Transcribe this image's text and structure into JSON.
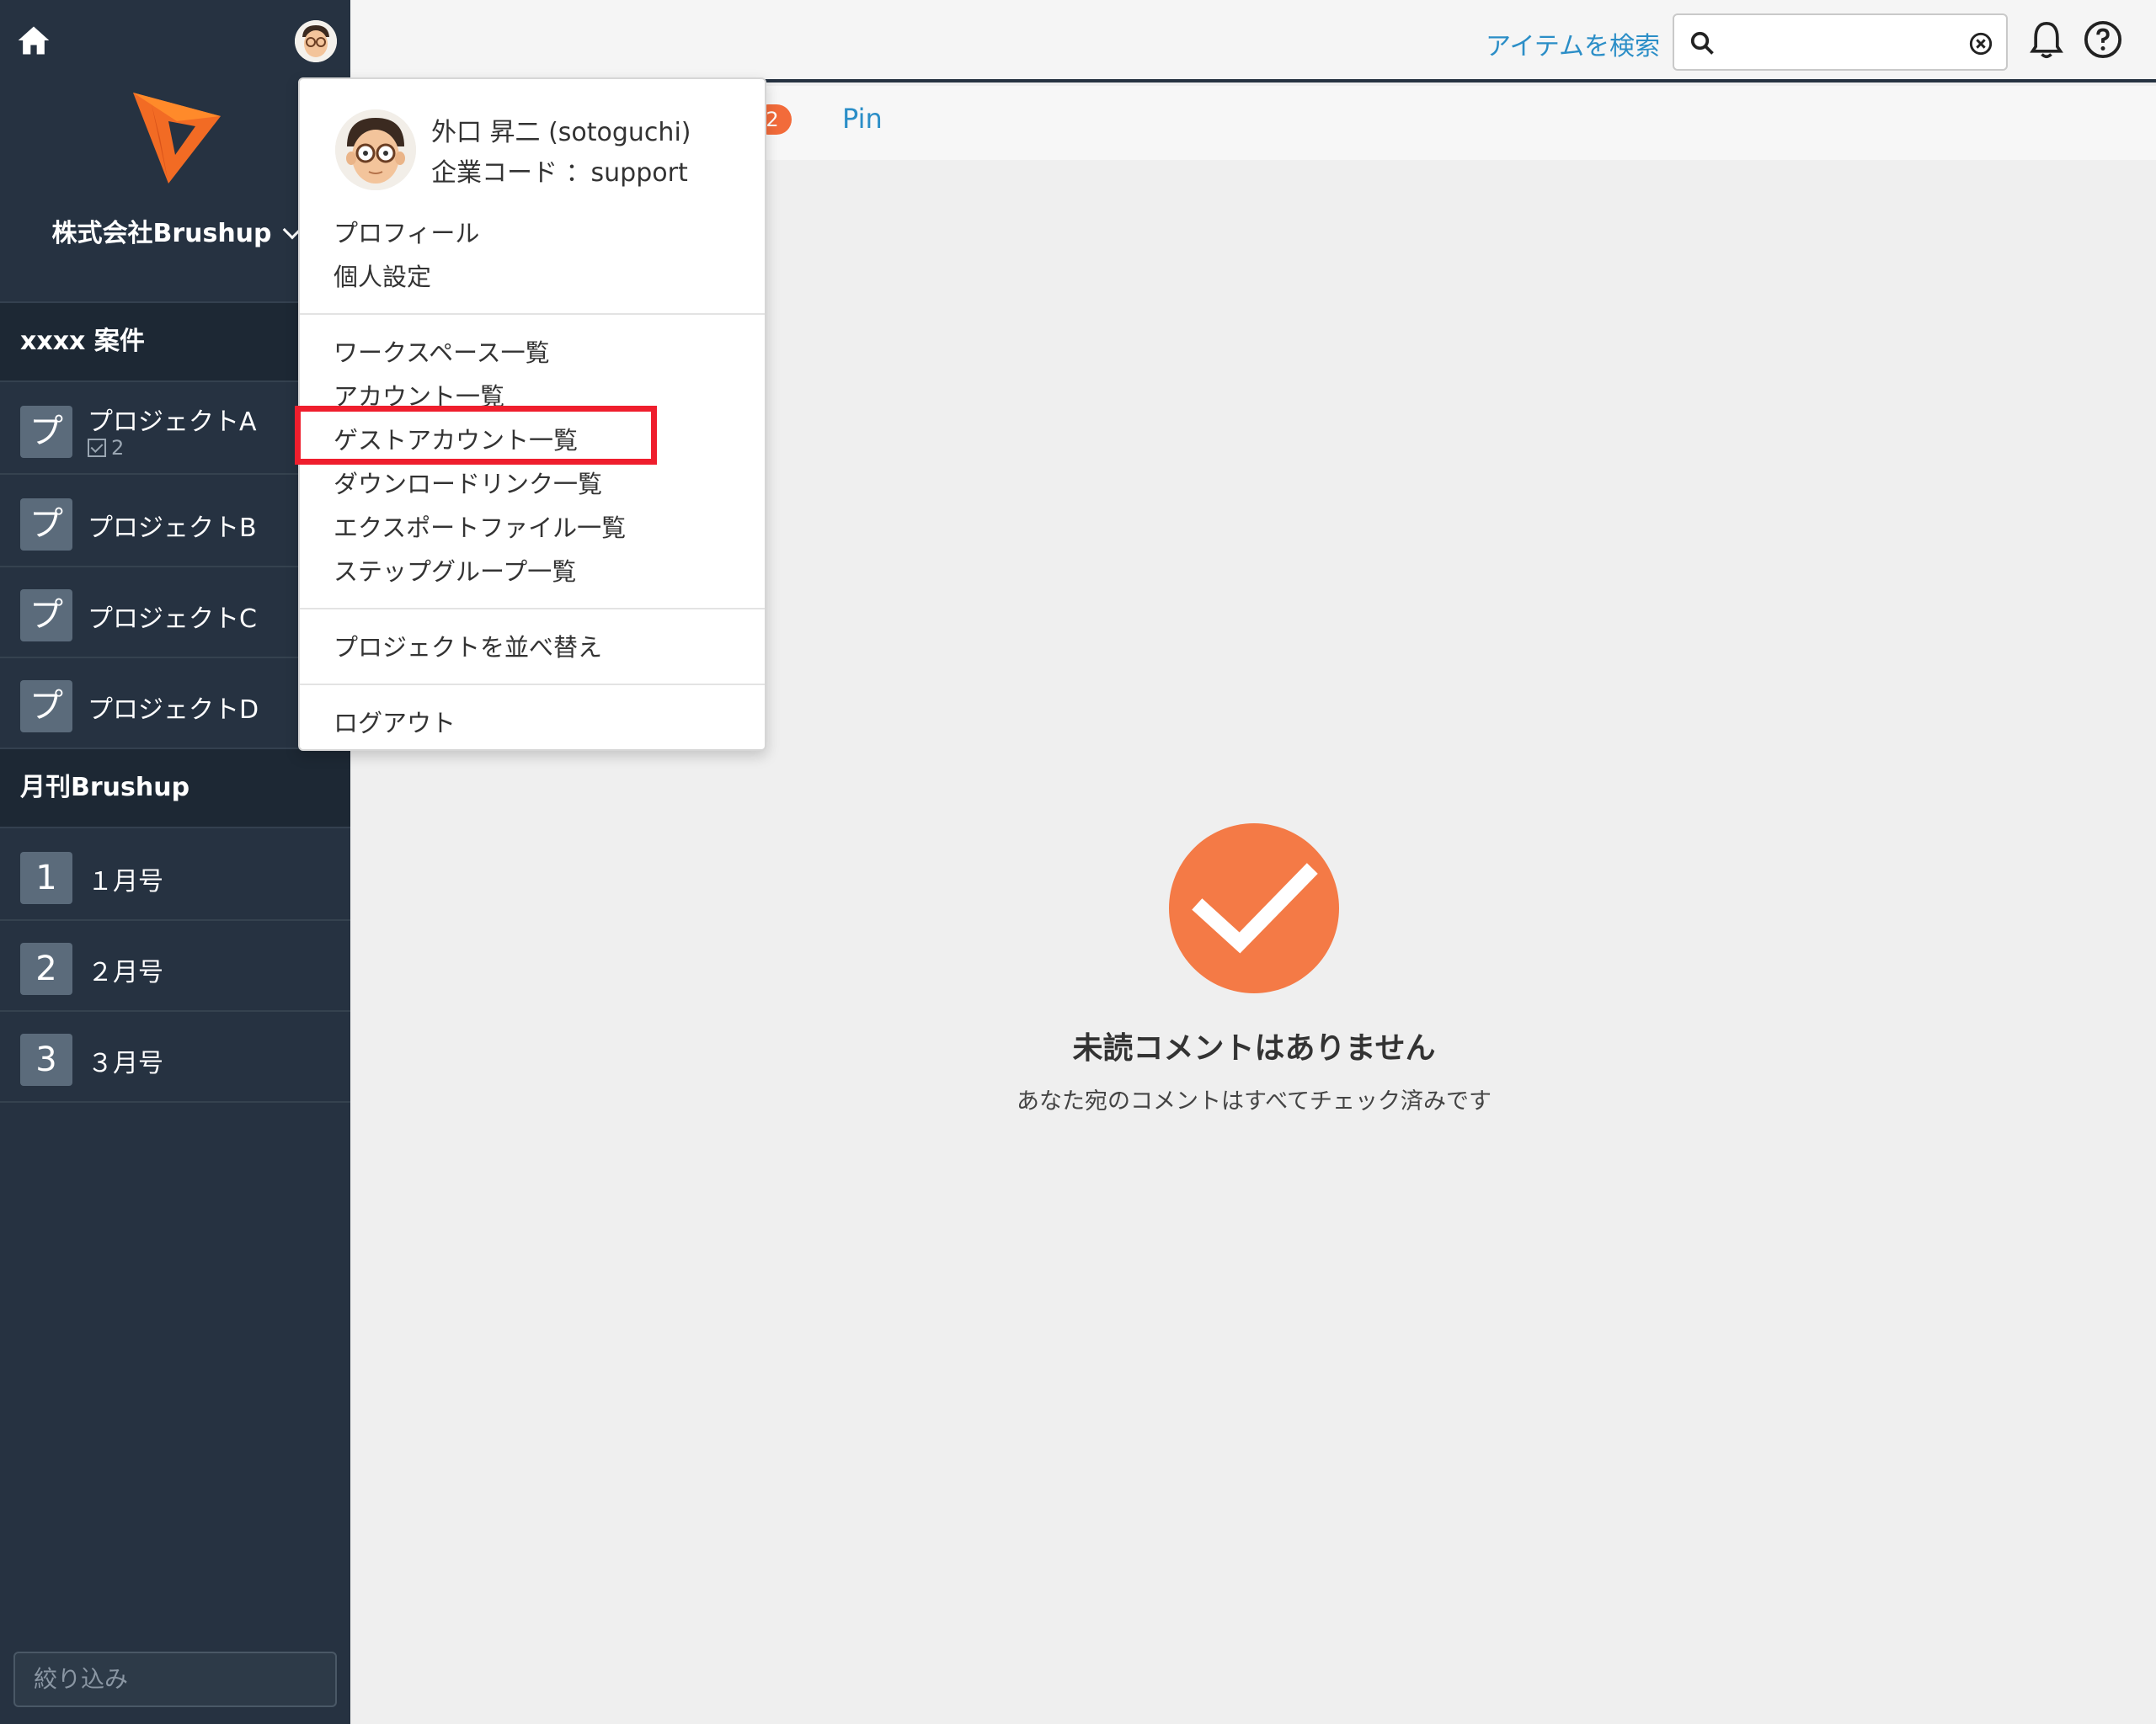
{
  "sidebar": {
    "company_name": "株式会社Brushup",
    "groups": [
      {
        "title": "xxxx 案件",
        "items": [
          {
            "badge": "プ",
            "label": "プロジェクトA",
            "count": "2"
          },
          {
            "badge": "プ",
            "label": "プロジェクトB"
          },
          {
            "badge": "プ",
            "label": "プロジェクトC"
          },
          {
            "badge": "プ",
            "label": "プロジェクトD"
          }
        ]
      },
      {
        "title": "月刊Brushup",
        "items": [
          {
            "badge": "1",
            "label": "１月号"
          },
          {
            "badge": "2",
            "label": "２月号"
          },
          {
            "badge": "3",
            "label": "３月号"
          }
        ]
      }
    ],
    "filter_placeholder": "絞り込み"
  },
  "header": {
    "search_link": "アイテムを検索",
    "search_value": ""
  },
  "tabs": {
    "count_badge": "2",
    "pin_label": "Pin"
  },
  "user_menu": {
    "user_name": "外口 昇二 (sotoguchi)",
    "company_code": "企業コード ：support",
    "section1": [
      "プロフィール",
      "個人設定"
    ],
    "section2": [
      "ワークスペース一覧",
      "アカウント一覧",
      "ゲストアカウント一覧",
      "ダウンロードリンク一覧",
      "エクスポートファイル一覧",
      "ステップグループ一覧"
    ],
    "section3": [
      "プロジェクトを並べ替え"
    ],
    "section4": [
      "ログアウト"
    ]
  },
  "empty_state": {
    "title": "未読コメントはありません",
    "subtitle": "あなた宛のコメントはすべてチェック済みです"
  },
  "colors": {
    "sidebar_bg": "#263241",
    "accent_orange": "#f47a46",
    "link_blue": "#2b8ec7",
    "highlight_red": "#ef1e2d"
  }
}
